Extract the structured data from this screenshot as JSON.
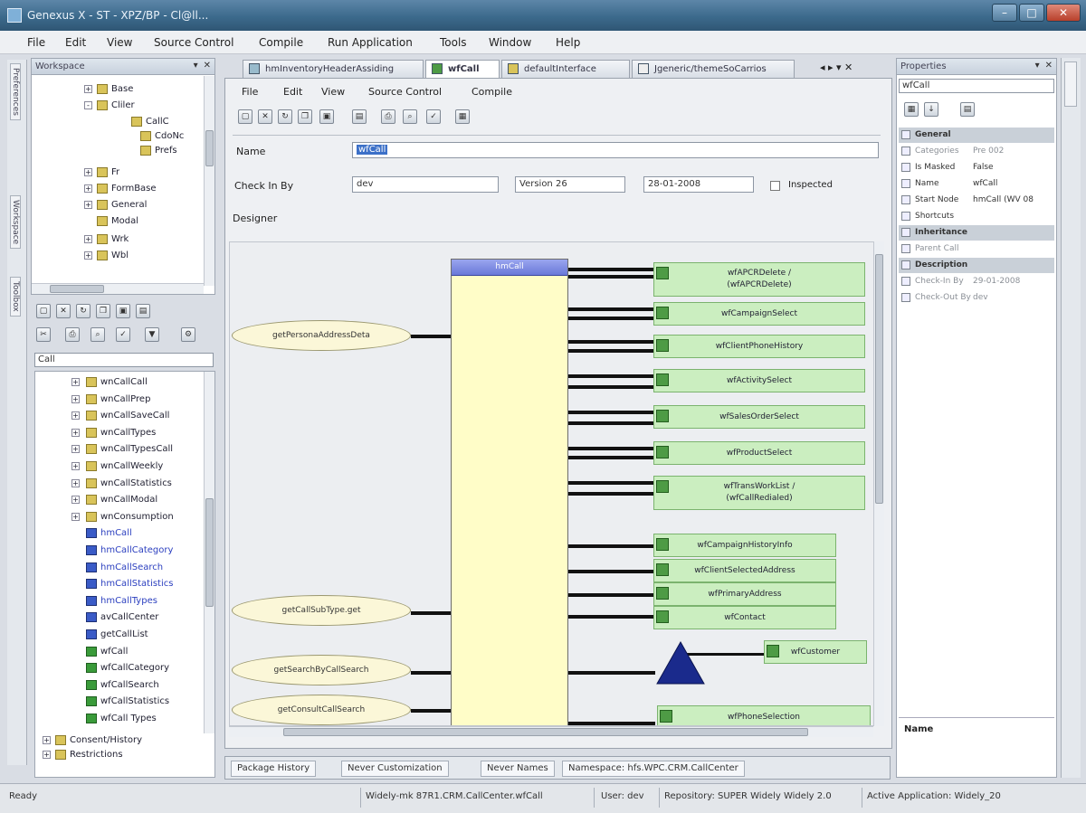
{
  "window": {
    "title": "Genexus X - ST - XPZ/BP - Cl@ll...",
    "minimize": "–",
    "maximize": "□",
    "close": "✕"
  },
  "menubar": [
    "File",
    "Edit",
    "View",
    "Source Control",
    "Compile",
    "Run Application",
    "Tools",
    "Window",
    "Help"
  ],
  "left_tabs": [
    "Preferences",
    "Workspace",
    "Toolbox"
  ],
  "kb_explorer": {
    "title": "Workspace",
    "tree_top": [
      {
        "label": "Base",
        "icon": "folder",
        "exp": "+"
      },
      {
        "label": "Cliler",
        "icon": "folder",
        "exp": "-"
      },
      {
        "label": "CallC",
        "icon": "folder",
        "exp": ""
      },
      {
        "label": "CdoNc",
        "icon": "folder",
        "exp": ""
      },
      {
        "label": "Prefs",
        "icon": "folder",
        "exp": ""
      },
      {
        "label": "Fr",
        "icon": "folder",
        "exp": "+"
      },
      {
        "label": "FormBase",
        "icon": "folder",
        "exp": "+"
      },
      {
        "label": "General",
        "icon": "folder",
        "exp": "+"
      },
      {
        "label": "Modal",
        "icon": "folder",
        "exp": ""
      },
      {
        "label": "Wrk",
        "icon": "folder",
        "exp": "+"
      },
      {
        "label": "Wbl",
        "icon": "folder",
        "exp": "+"
      }
    ],
    "filter_value": "Call",
    "tree_bottom": [
      {
        "label": "wnCallCall",
        "icon": "folder",
        "link": false
      },
      {
        "label": "wnCallPrep",
        "icon": "folder",
        "link": false
      },
      {
        "label": "wnCallSaveCall",
        "icon": "folder",
        "link": false
      },
      {
        "label": "wnCallTypes",
        "icon": "folder",
        "link": false
      },
      {
        "label": "wnCallTypesCall",
        "icon": "folder",
        "link": false
      },
      {
        "label": "wnCallWeekly",
        "icon": "folder",
        "link": false
      },
      {
        "label": "wnCallStatistics",
        "icon": "folder",
        "link": false
      },
      {
        "label": "wnCallModal",
        "icon": "folder",
        "link": false
      },
      {
        "label": "wnConsumption",
        "icon": "folder",
        "link": false
      },
      {
        "label": "hmCall",
        "icon": "blue",
        "link": true
      },
      {
        "label": "hmCallCategory",
        "icon": "blue",
        "link": true
      },
      {
        "label": "hmCallSearch",
        "icon": "blue",
        "link": true
      },
      {
        "label": "hmCallStatistics",
        "icon": "blue",
        "link": true
      },
      {
        "label": "hmCallTypes",
        "icon": "blue",
        "link": true
      },
      {
        "label": "avCallCenter",
        "icon": "blue",
        "link": false
      },
      {
        "label": "getCallList",
        "icon": "blue",
        "link": false
      },
      {
        "label": "wfCall",
        "icon": "green",
        "link": false
      },
      {
        "label": "wfCallCategory",
        "icon": "green",
        "link": false
      },
      {
        "label": "wfCallSearch",
        "icon": "green",
        "link": false
      },
      {
        "label": "wfCallStatistics",
        "icon": "green",
        "link": false
      },
      {
        "label": "wfCall Types",
        "icon": "green",
        "link": false
      }
    ],
    "footer_items": [
      "Consent/History",
      "Restrictions"
    ]
  },
  "doc_tabs": [
    {
      "label": "hmInventoryHeaderAssiding",
      "active": false
    },
    {
      "label": "wfCall",
      "active": true
    },
    {
      "label": "defaultInterface",
      "active": false
    },
    {
      "label": "Jgeneric/themeSoCarrios",
      "active": false
    }
  ],
  "editor": {
    "menu": [
      "File",
      "Edit",
      "View",
      "Source Control",
      "Compile"
    ],
    "name_label": "Name",
    "name_value": "wfCall",
    "checkin_label": "Check In By",
    "checkin_user": "dev",
    "checkin_version": "Version 26",
    "checkin_date": "28-01-2008",
    "inspected_label": "Inspected",
    "designer_label": "Designer"
  },
  "diagram": {
    "main_box_title": "hmCall",
    "left_nodes": [
      "getPersonaAddressDeta",
      "getCallSubType.get",
      "getSearchByCallSearch",
      "getConsultCallSearch"
    ],
    "right_nodes": [
      {
        "label": "wfAPCRDelete /\n(wfAPCRDelete)",
        "tall": true
      },
      {
        "label": "wfCampaignSelect",
        "tall": false
      },
      {
        "label": "wfClientPhoneHistory",
        "tall": false
      },
      {
        "label": "wfActivitySelect",
        "tall": false
      },
      {
        "label": "wfSalesOrderSelect",
        "tall": false
      },
      {
        "label": "wfProductSelect",
        "tall": false
      },
      {
        "label": "wfTransWorkList /\n(wfCallRedialed)",
        "tall": true
      }
    ],
    "right_nodes2": [
      "wfCampaignHistoryInfo",
      "wfClientSelectedAddress",
      "wfPrimaryAddress",
      "wfContact"
    ],
    "far_node": "wfCustomer",
    "bottom_node": "wfPhoneSelection"
  },
  "bottom_tabs": [
    "Package History",
    "Never Customization",
    "Never Names",
    "Namespace: hfs.WPC.CRM.CallCenter"
  ],
  "properties": {
    "title": "Properties",
    "object": "wfCall",
    "rows": [
      {
        "k": "General",
        "v": "",
        "cat": true
      },
      {
        "k": "Categories",
        "v": "Pre 002",
        "grey": true
      },
      {
        "k": "Is Masked",
        "v": "False",
        "grey": false
      },
      {
        "k": "Name",
        "v": "wfCall",
        "grey": false
      },
      {
        "k": "Start Node",
        "v": "hmCall (WV 08",
        "grey": false
      },
      {
        "k": "Shortcuts",
        "v": "",
        "grey": false
      },
      {
        "k": "Inheritance",
        "v": "",
        "cat": true
      },
      {
        "k": "Parent Call",
        "v": "",
        "grey": true
      },
      {
        "k": "Description",
        "v": "",
        "cat": true
      },
      {
        "k": "Check-In By",
        "v": "29-01-2008",
        "grey": true
      },
      {
        "k": "Check-Out By",
        "v": "dev",
        "grey": true
      }
    ],
    "footer_label": "Name"
  },
  "status": {
    "left": "Ready",
    "doc": "Widely-mk 87R1.CRM.CallCenter.wfCall",
    "user": "User: dev",
    "repo": "Repository: SUPER Widely Widely 2.0",
    "app": "Active Application: Widely_20"
  }
}
